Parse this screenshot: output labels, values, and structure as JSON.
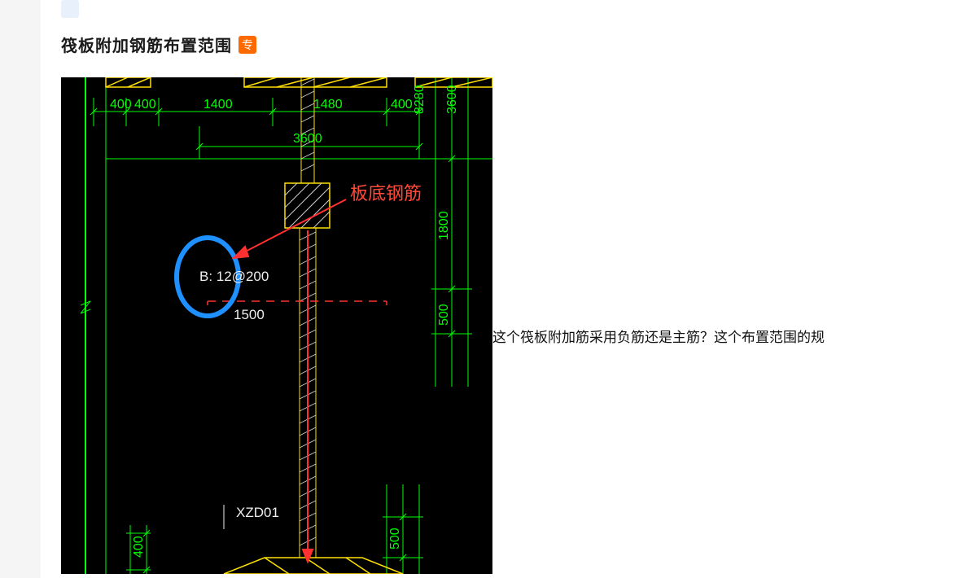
{
  "title": "筏板附加钢筋布置范围",
  "badge": "专",
  "question": "这个筏板附加筋采用负筋还是主筋？这个布置范围的规",
  "annotation": {
    "red_label": "板底钢筋",
    "rebar_text": "B: 12@200",
    "dim_below": "1500",
    "element_label": "XZD01"
  },
  "dims": {
    "top_row1": [
      "400",
      "400",
      "1400",
      "1480",
      "400"
    ],
    "top_row1_right_v": [
      "8280",
      "3600"
    ],
    "top_row2": "3600",
    "right_col": [
      "1800",
      "500"
    ],
    "bottom_left": "400",
    "bottom_right": "500"
  }
}
